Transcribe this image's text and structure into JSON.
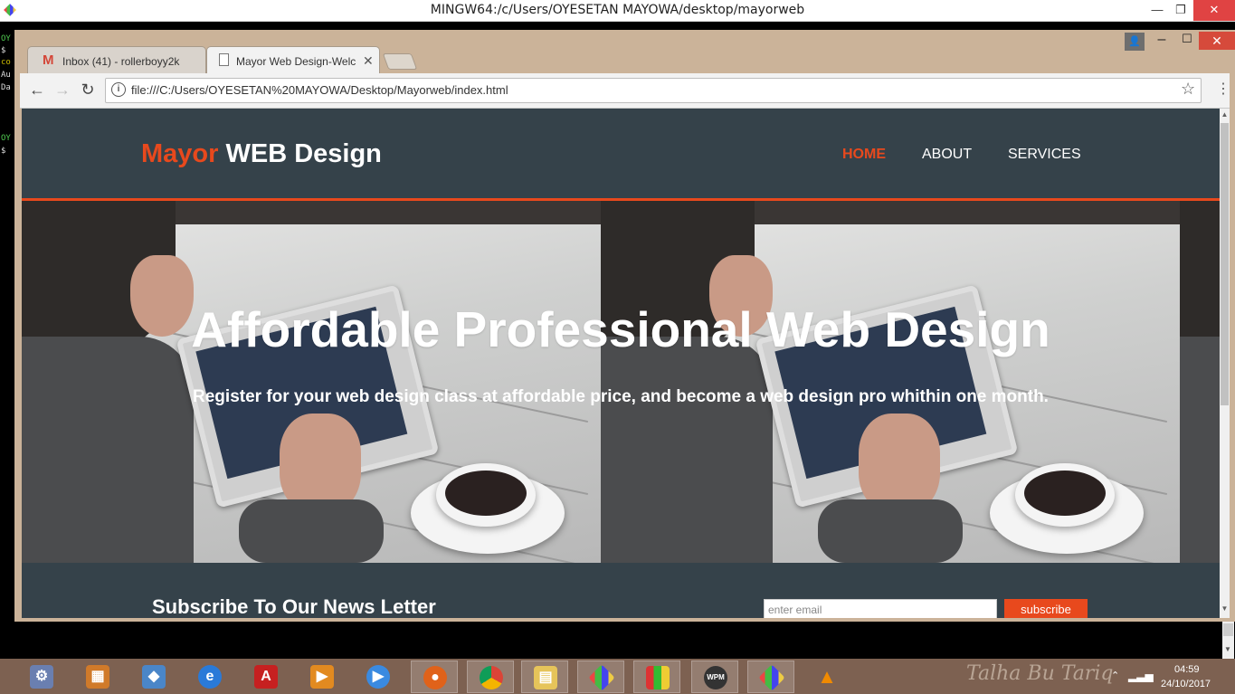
{
  "terminal": {
    "title": "MINGW64:/c/Users/OYESETAN MAYOWA/desktop/mayorweb",
    "lines_top": [
      "OY",
      "$",
      "co",
      "Au",
      "Da"
    ],
    "lines_bottom": [
      "OY",
      "$"
    ]
  },
  "browser": {
    "tabs": [
      {
        "label": "Inbox (41) - rollerboyy2k",
        "icon": "gmail-icon"
      },
      {
        "label": "Mayor Web Design-Welc",
        "icon": "page-icon"
      }
    ],
    "url": "file:///C:/Users/OYESETAN%20MAYOWA/Desktop/Mayorweb/index.html"
  },
  "site": {
    "logo_highlight": "Mayor",
    "logo_rest": " WEB Design",
    "nav": [
      {
        "label": "HOME",
        "active": true
      },
      {
        "label": "ABOUT",
        "active": false
      },
      {
        "label": "SERVICES",
        "active": false
      }
    ],
    "hero_title": "Affordable Professional Web Design",
    "hero_subtitle": "Register for your web design class at affordable price, and become a web design pro whithin one month.",
    "newsletter_title": "Subscribe To Our News Letter",
    "newsletter_placeholder": "enter email",
    "newsletter_button": "subscribe"
  },
  "taskbar": {
    "signature": "Talha Bu Tariq",
    "time": "04:59",
    "date": "24/10/2017"
  },
  "colors": {
    "header_bg": "#35424a",
    "accent": "#e8491d",
    "taskbar": "#7d6151",
    "chrome_frame": "#cbb399"
  }
}
